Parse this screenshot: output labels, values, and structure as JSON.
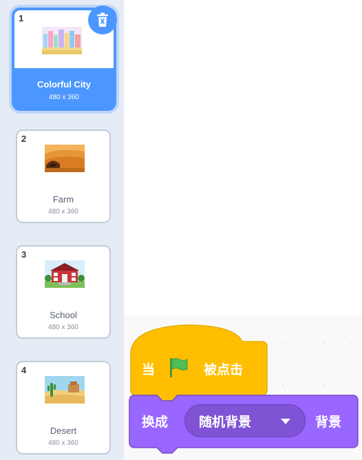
{
  "backdrops": [
    {
      "number": "1",
      "name": "Colorful City",
      "size": "480 x 360",
      "selected": true,
      "thumb_icon": "colorful-city-thumbnail"
    },
    {
      "number": "2",
      "name": "Farm",
      "size": "480 x 360",
      "selected": false,
      "thumb_icon": "farm-thumbnail"
    },
    {
      "number": "3",
      "name": "School",
      "size": "480 x 360",
      "selected": false,
      "thumb_icon": "school-thumbnail"
    },
    {
      "number": "4",
      "name": "Desert",
      "size": "480 x 360",
      "selected": false,
      "thumb_icon": "desert-thumbnail"
    }
  ],
  "delete_icon": "trash-icon",
  "blocks": {
    "hat": {
      "prefix": "当",
      "suffix": "被点击",
      "icon": "green-flag-icon",
      "color": "#ffbf00"
    },
    "switch": {
      "label": "换成",
      "dropdown_value": "随机背景",
      "suffix": "背景",
      "color": "#9966ff"
    }
  },
  "colors": {
    "accent": "#4c97ff",
    "events": "#ffbf00",
    "looks": "#9966ff"
  }
}
